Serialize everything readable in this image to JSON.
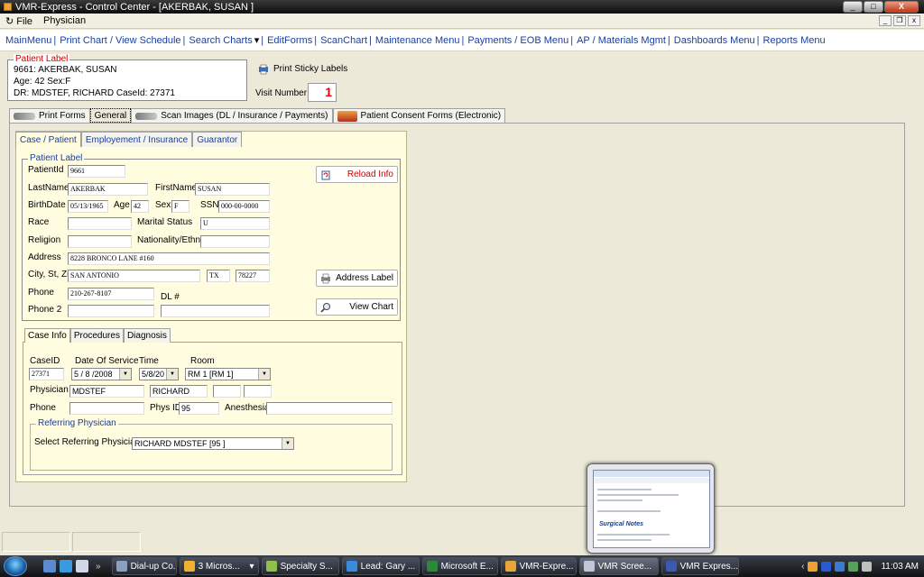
{
  "window": {
    "title": "VMR-Express - Control Center - [AKERBAK, SUSAN    ]",
    "minimize": "_",
    "maximize": "□",
    "close": "X"
  },
  "menu": {
    "items": [
      "File",
      "Physician"
    ]
  },
  "nav": {
    "items": [
      "MainMenu",
      "Print Chart / View Schedule",
      "Search Charts",
      "EditForms",
      "ScanChart",
      "Maintenance Menu",
      "Payments / EOB Menu",
      "AP / Materials Mgmt",
      "Dashboards Menu",
      "Reports Menu"
    ],
    "separator": "|",
    "dropdown_marker": "▾"
  },
  "patient_label": {
    "legend": "Patient Label",
    "line1": "9661: AKERBAK, SUSAN",
    "line2": "Age: 42    Sex:F",
    "line3": "DR: MDSTEF, RICHARD    CaseId: 27371"
  },
  "sticky": {
    "label": "Print Sticky Labels"
  },
  "visit": {
    "label": "Visit Number",
    "value": "1"
  },
  "main_tabs": [
    "Print Forms",
    "General",
    "Scan Images (DL / Insurance / Payments)",
    "Patient Consent Forms (Electronic)"
  ],
  "sub_tabs": [
    "Case / Patient",
    "Employement / Insurance",
    "Guarantor"
  ],
  "patient_form": {
    "legend": "Patient Label",
    "labels": {
      "patient_id": "PatientId",
      "last_name": "LastName",
      "first_name": "FirstName",
      "birth_date": "BirthDate",
      "age": "Age",
      "sex": "Sex",
      "ssn": "SSN",
      "race": "Race",
      "marital": "Marital Status",
      "religion": "Religion",
      "nationality": "Nationality/Ethnic",
      "address": "Address",
      "city": "City, St, Zip",
      "phone": "Phone",
      "dl": "DL #",
      "phone2": "Phone 2"
    },
    "values": {
      "patient_id": "9661",
      "last_name": "AKERBAK",
      "first_name": "SUSAN",
      "birth_date": "05/13/1965",
      "age": "42",
      "sex": "F",
      "ssn": "000-00-0000",
      "race": "",
      "marital": "U",
      "religion": "",
      "nationality": "",
      "address": "8228 BRONCO LANE #160",
      "city": "SAN ANTONIO",
      "state": "TX",
      "zip": "78227",
      "phone": "210-267-8107",
      "dl": "",
      "phone2": ""
    }
  },
  "buttons": {
    "reload": "Reload Info",
    "address_label": "Address Label",
    "view_chart": "View Chart"
  },
  "case_tabs": [
    "Case Info",
    "Procedures",
    "Diagnosis"
  ],
  "case_info": {
    "labels": {
      "case_id": "CaseID",
      "dos": "Date Of Service",
      "time": "Time",
      "room": "Room",
      "physician": "Physician",
      "phone": "Phone",
      "phys_id": "Phys ID",
      "anesthesia": "Anesthesia"
    },
    "values": {
      "case_id": "27371",
      "dos": "5 / 8 /2008",
      "time": "5/8/20",
      "room": "RM 1 [RM 1]",
      "phys_last": "MDSTEF",
      "phys_first": "RICHARD",
      "phys_id": "95"
    }
  },
  "referring": {
    "legend": "Referring Physician",
    "label": "Select Referring Physician",
    "value": "RICHARD MDSTEF [95     ]"
  },
  "thumbnail": {
    "text": "Surgical Notes"
  },
  "taskbar": {
    "items": [
      "Dial-up Co...",
      "3 Micros...",
      "Specialty S...",
      "Lead: Gary ...",
      "Microsoft E...",
      "VMR-Expre...",
      "VMR Scree...",
      "VMR Expres..."
    ],
    "clock": "11:03 AM"
  }
}
